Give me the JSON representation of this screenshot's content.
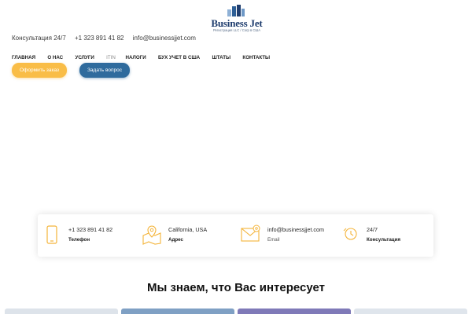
{
  "brand": {
    "name": "Business Jet",
    "tagline": "Регистрация LLC / Corp в США",
    "logo_icon": "city-buildings-icon"
  },
  "topbar": {
    "consult_label": "Консультация 24/7",
    "phone": "+1 323 891 41 82",
    "email": "info@businessjjet.com"
  },
  "nav": {
    "items": [
      {
        "label": "ГЛАВНАЯ"
      },
      {
        "label": "О НАС"
      },
      {
        "label": "УСЛУГИ"
      },
      {
        "label": "ITIN"
      },
      {
        "label": "НАЛОГИ"
      },
      {
        "label": "БУХ УЧЕТ В США"
      },
      {
        "label": "ШТАТЫ"
      },
      {
        "label": "КОНТАКТЫ"
      }
    ]
  },
  "buttons": {
    "order_label": "Оформить заказ",
    "ask_label": "Задать вопрос"
  },
  "contact_card": {
    "phone": {
      "value": "+1 323 891 41 82",
      "label": "Телефон",
      "icon": "phone-icon"
    },
    "address": {
      "value": "California, USA",
      "label": "Адрес",
      "icon": "map-pin-icon"
    },
    "email": {
      "value": "info@businessjjet.com",
      "label": "Email",
      "icon": "mail-icon"
    },
    "hours": {
      "value": "24/7",
      "label": "Консультация",
      "icon": "clock-icon"
    }
  },
  "section": {
    "heading": "Мы знаем, что Вас интересует"
  },
  "colors": {
    "accent_orange": "#f9bd47",
    "accent_blue": "#2f6b9d",
    "brand_navy": "#1f3d6e"
  }
}
